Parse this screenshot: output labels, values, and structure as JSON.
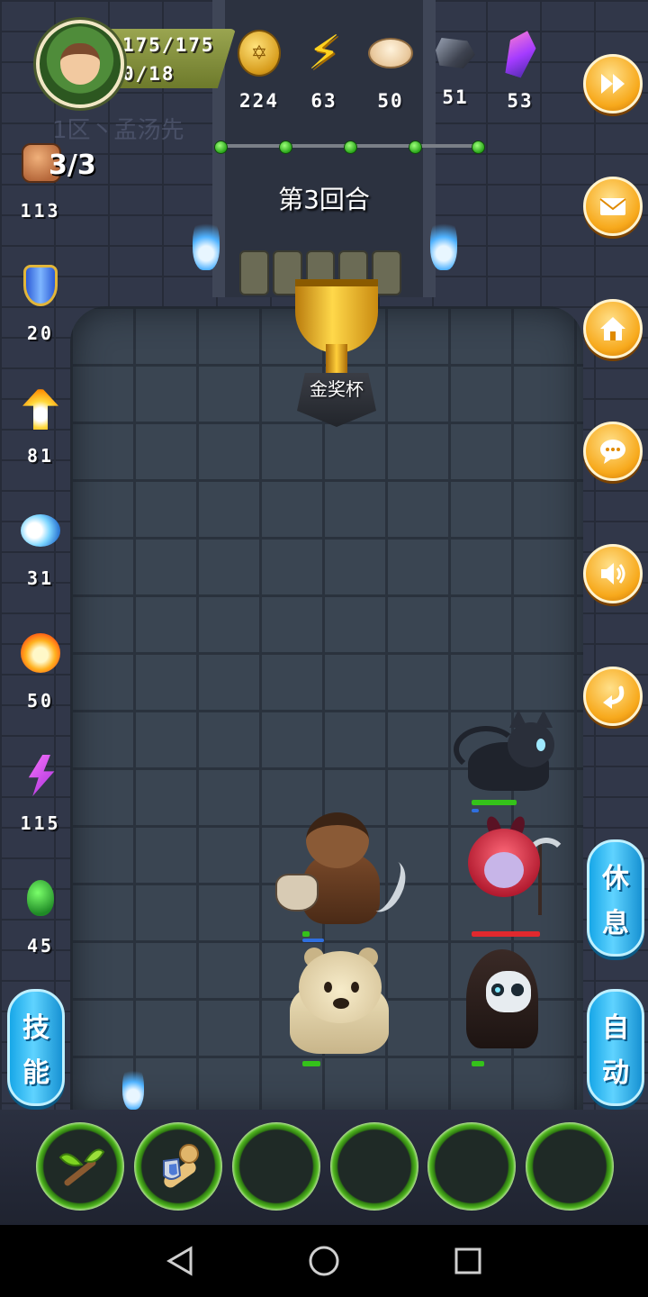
{
  "player": {
    "hp": "175/175",
    "progress": "0/18"
  },
  "resources": [
    {
      "name": "gold-coin",
      "icon": "coin-icon",
      "value": "224"
    },
    {
      "name": "energy",
      "icon": "lightning-bolt-icon",
      "value": "63"
    },
    {
      "name": "bun",
      "icon": "steamed-bun-icon",
      "value": "50"
    },
    {
      "name": "ore",
      "icon": "iron-ore-icon",
      "value": "51"
    },
    {
      "name": "crystal",
      "icon": "crystal-icon",
      "value": "53"
    }
  ],
  "background_text": "1区丶孟汤先",
  "stage": {
    "round_label": "第3回合",
    "trophy_label": "金奖杯",
    "round_progress": {
      "total_dots": 5,
      "filled_dots": 5
    }
  },
  "left_stats": {
    "attacks_remaining": "3/3",
    "items": [
      {
        "icon": "fist-icon",
        "value": "113"
      },
      {
        "icon": "shield-icon",
        "value": "20"
      },
      {
        "icon": "flame-arrow-icon",
        "value": "81"
      },
      {
        "icon": "water-swirl-icon",
        "value": "31"
      },
      {
        "icon": "fireball-icon",
        "value": "50"
      },
      {
        "icon": "purple-lightning-icon",
        "value": "115"
      },
      {
        "icon": "green-blob-icon",
        "value": "45"
      }
    ]
  },
  "right_buttons": [
    {
      "icon": "fast-forward-icon"
    },
    {
      "icon": "mail-icon"
    },
    {
      "icon": "home-icon"
    },
    {
      "icon": "chat-icon"
    },
    {
      "icon": "sound-icon"
    },
    {
      "icon": "return-icon"
    }
  ],
  "side_buttons": {
    "rest": {
      "line1": "休",
      "line2": "息"
    },
    "auto": {
      "line1": "自",
      "line2": "动"
    },
    "skill": {
      "line1": "技",
      "line2": "能"
    }
  },
  "units": {
    "black_cat": {
      "hp_fraction": 1.0,
      "hp_color": "#34c21a"
    },
    "red_demon": {
      "hp_fraction": 1.0,
      "hp_color": "#e0292e"
    },
    "horned_warrior": {
      "hp_fraction": 0.3,
      "hp_color": "#34c21a"
    },
    "cream_bear": {
      "hp_fraction": 0.5,
      "hp_color": "#34c21a"
    },
    "hooded_skull": {
      "hp_fraction": 0.3,
      "hp_color": "#34c21a"
    }
  },
  "skill_slots": [
    {
      "icon": "sprout-staff-icon",
      "filled": true
    },
    {
      "icon": "rose-shield-scroll-icon",
      "filled": true
    },
    {
      "icon": "empty-slot",
      "filled": false
    },
    {
      "icon": "empty-slot",
      "filled": false
    },
    {
      "icon": "empty-slot",
      "filled": false
    },
    {
      "icon": "empty-slot",
      "filled": false
    }
  ],
  "colors": {
    "accent_orange": "#f7a91c",
    "accent_blue": "#17a7e8",
    "hp_green": "#34c21a",
    "hp_red": "#e0292e"
  }
}
